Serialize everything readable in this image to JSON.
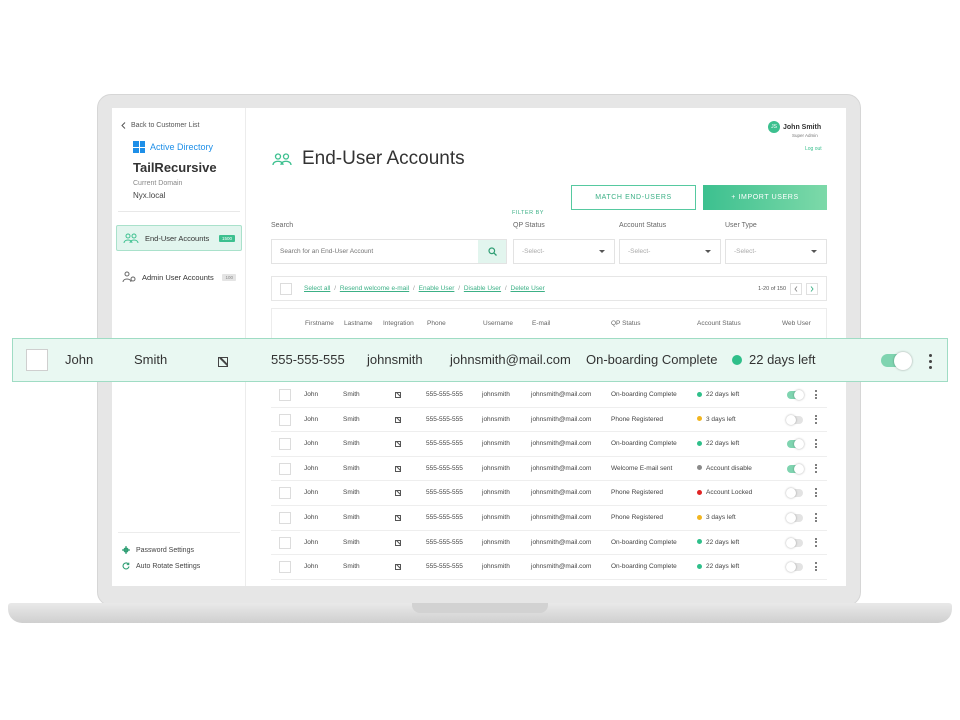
{
  "sidebar": {
    "back_label": "Back to Customer List",
    "directory_label": "Active Directory",
    "org_name": "TailRecursive",
    "domain_label": "Current Domain",
    "domain_value": "Nyx.local",
    "items": [
      {
        "label": "End-User Accounts",
        "badge": "1500",
        "icon": "users-icon",
        "active": true
      },
      {
        "label": "Admin User Accounts",
        "badge": "100",
        "icon": "admin-users-icon",
        "active": false
      }
    ],
    "settings": [
      {
        "label": "Password Settings",
        "icon": "gear-icon"
      },
      {
        "label": "Auto Rotate Settings",
        "icon": "rotate-icon"
      }
    ]
  },
  "user": {
    "initials": "JS",
    "name": "John Smith",
    "role": "Super Admin",
    "logout_label": "Log out"
  },
  "header": {
    "title": "End-User Accounts",
    "match_button": "MATCH END-USERS",
    "import_button": "+ IMPORT USERS"
  },
  "filters": {
    "filter_by_label": "FILTER BY",
    "search_label": "Search",
    "search_placeholder": "Search for an End-User Account",
    "qp_status_label": "QP Status",
    "account_status_label": "Account Status",
    "user_type_label": "User Type",
    "qp_status_value": "-Select-",
    "account_status_value": "-Select-",
    "user_type_value": "-Select-"
  },
  "actions": {
    "select_all": "Select all",
    "resend": "Resend  welcome e-mail",
    "enable": "Enable User",
    "disable": "Disable User",
    "delete": "Delete User",
    "separator": "/",
    "pagination": "1-20 of 150"
  },
  "table": {
    "columns": [
      "Firstname",
      "Lastname",
      "Integration",
      "Phone",
      "Username",
      "E-mail",
      "QP Status",
      "Account Status",
      "Web User"
    ],
    "highlighted_row": {
      "first": "John",
      "last": "Smith",
      "phone": "555-555-555",
      "username": "johnsmith",
      "email": "johnsmith@mail.com",
      "qp_status": "On-boarding Complete",
      "account_status": "22 days left",
      "status_color": "#2fbf8a",
      "web_user": true
    },
    "rows": [
      {
        "first": "John",
        "last": "Smith",
        "phone": "555-555-555",
        "username": "johnsmith",
        "email": "johnsmith@mail.com",
        "qp_status": "On-boarding Complete",
        "account_status": "22 days left",
        "status_color": "#2fbf8a",
        "web_user": true
      },
      {
        "first": "John",
        "last": "Smith",
        "phone": "555-555-555",
        "username": "johnsmith",
        "email": "johnsmith@mail.com",
        "qp_status": "Phone Registered",
        "account_status": "3 days left",
        "status_color": "#f2b51f",
        "web_user": false
      },
      {
        "first": "John",
        "last": "Smith",
        "phone": "555-555-555",
        "username": "johnsmith",
        "email": "johnsmith@mail.com",
        "qp_status": "On-boarding Complete",
        "account_status": "22 days left",
        "status_color": "#2fbf8a",
        "web_user": true
      },
      {
        "first": "John",
        "last": "Smith",
        "phone": "555-555-555",
        "username": "johnsmith",
        "email": "johnsmith@mail.com",
        "qp_status": "Welcome E-mail sent",
        "account_status": "Account disable",
        "status_color": "#8a8a8a",
        "web_user": true
      },
      {
        "first": "John",
        "last": "Smith",
        "phone": "555-555-555",
        "username": "johnsmith",
        "email": "johnsmith@mail.com",
        "qp_status": "Phone Registered",
        "account_status": "Account Locked",
        "status_color": "#e02424",
        "web_user": false
      },
      {
        "first": "John",
        "last": "Smith",
        "phone": "555-555-555",
        "username": "johnsmith",
        "email": "johnsmith@mail.com",
        "qp_status": "Phone Registered",
        "account_status": "3 days left",
        "status_color": "#f2b51f",
        "web_user": false
      },
      {
        "first": "John",
        "last": "Smith",
        "phone": "555-555-555",
        "username": "johnsmith",
        "email": "johnsmith@mail.com",
        "qp_status": "On-boarding Complete",
        "account_status": "22 days left",
        "status_color": "#2fbf8a",
        "web_user": false
      },
      {
        "first": "John",
        "last": "Smith",
        "phone": "555-555-555",
        "username": "johnsmith",
        "email": "johnsmith@mail.com",
        "qp_status": "On-boarding Complete",
        "account_status": "22 days left",
        "status_color": "#2fbf8a",
        "web_user": false
      }
    ]
  },
  "colors": {
    "accent": "#3cc08f",
    "accent_light": "#e2f5ee",
    "link": "#3cb086"
  }
}
